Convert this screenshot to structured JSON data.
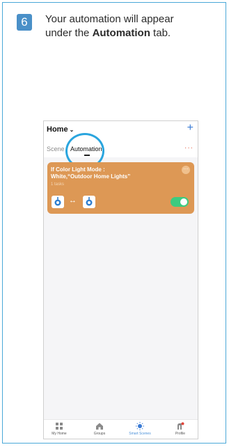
{
  "step": {
    "number": "6",
    "line1": "Your automation will appear",
    "line2_before": "under the ",
    "line2_bold": "Automation",
    "line2_after": " tab."
  },
  "header": {
    "home_label": "Home",
    "chevron": "⌄",
    "plus": "+",
    "more": "···"
  },
  "tabs": {
    "scene": "Scene",
    "automation": "Automation"
  },
  "automation_card": {
    "title_line1": "If Color Light Mode :",
    "title_line2": "White,“Outdoor Home Lights”",
    "tasks": "1 tasks",
    "more": "···",
    "arrow": "↔",
    "enabled": true,
    "color": "#dd9855"
  },
  "bottom_nav": [
    {
      "label": "My Home",
      "icon": "grid-icon"
    },
    {
      "label": "Groups",
      "icon": "house-icon"
    },
    {
      "label": "Smart Scenes",
      "icon": "sun-icon"
    },
    {
      "label": "Profile",
      "icon": "profile-icon"
    }
  ],
  "colors": {
    "accent": "#2aa5de",
    "badge": "#4a90c8",
    "toggle_on": "#3ccb7f"
  }
}
